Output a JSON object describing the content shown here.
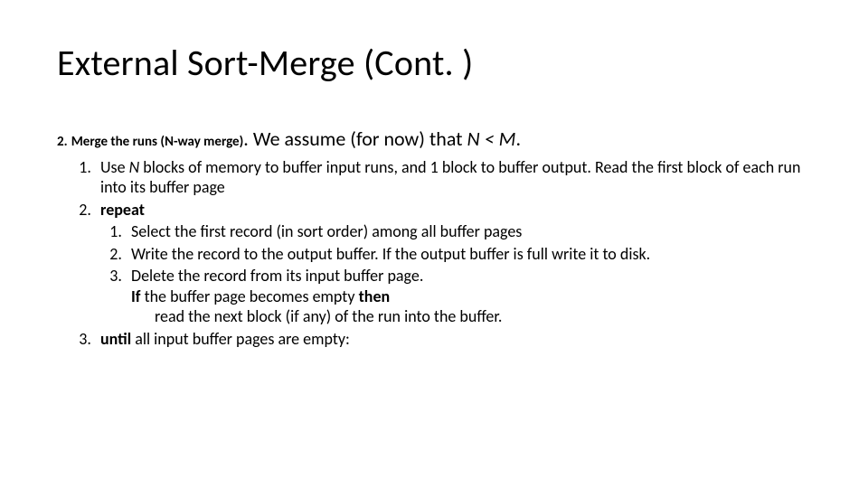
{
  "title": "External Sort-Merge (Cont. )",
  "lead": {
    "num": "2.",
    "bold": "Merge the runs (N-way merge)",
    "period": ". ",
    "rest_a": "We assume (for now) that ",
    "rest_ital": "N < M",
    "rest_b": "."
  },
  "steps": {
    "s1_a": "Use ",
    "s1_n": "N",
    "s1_b": " blocks of memory to buffer input runs, and 1 block to buffer output. Read the first block of each run into its buffer page",
    "s2": "repeat",
    "s2_1": "Select the first record (in sort order) among all buffer pages",
    "s2_2": "Write the record to the output buffer.  If the output buffer is full write it to disk.",
    "s2_3_a": "Delete the record from its input buffer page.",
    "s2_3_if": "If",
    "s2_3_b": " the buffer page becomes empty ",
    "s2_3_then": "then",
    "s2_3_c": "read the next block (if any) of the run into the buffer.",
    "s3_until": "until",
    "s3_rest": " all input buffer pages are empty:"
  }
}
